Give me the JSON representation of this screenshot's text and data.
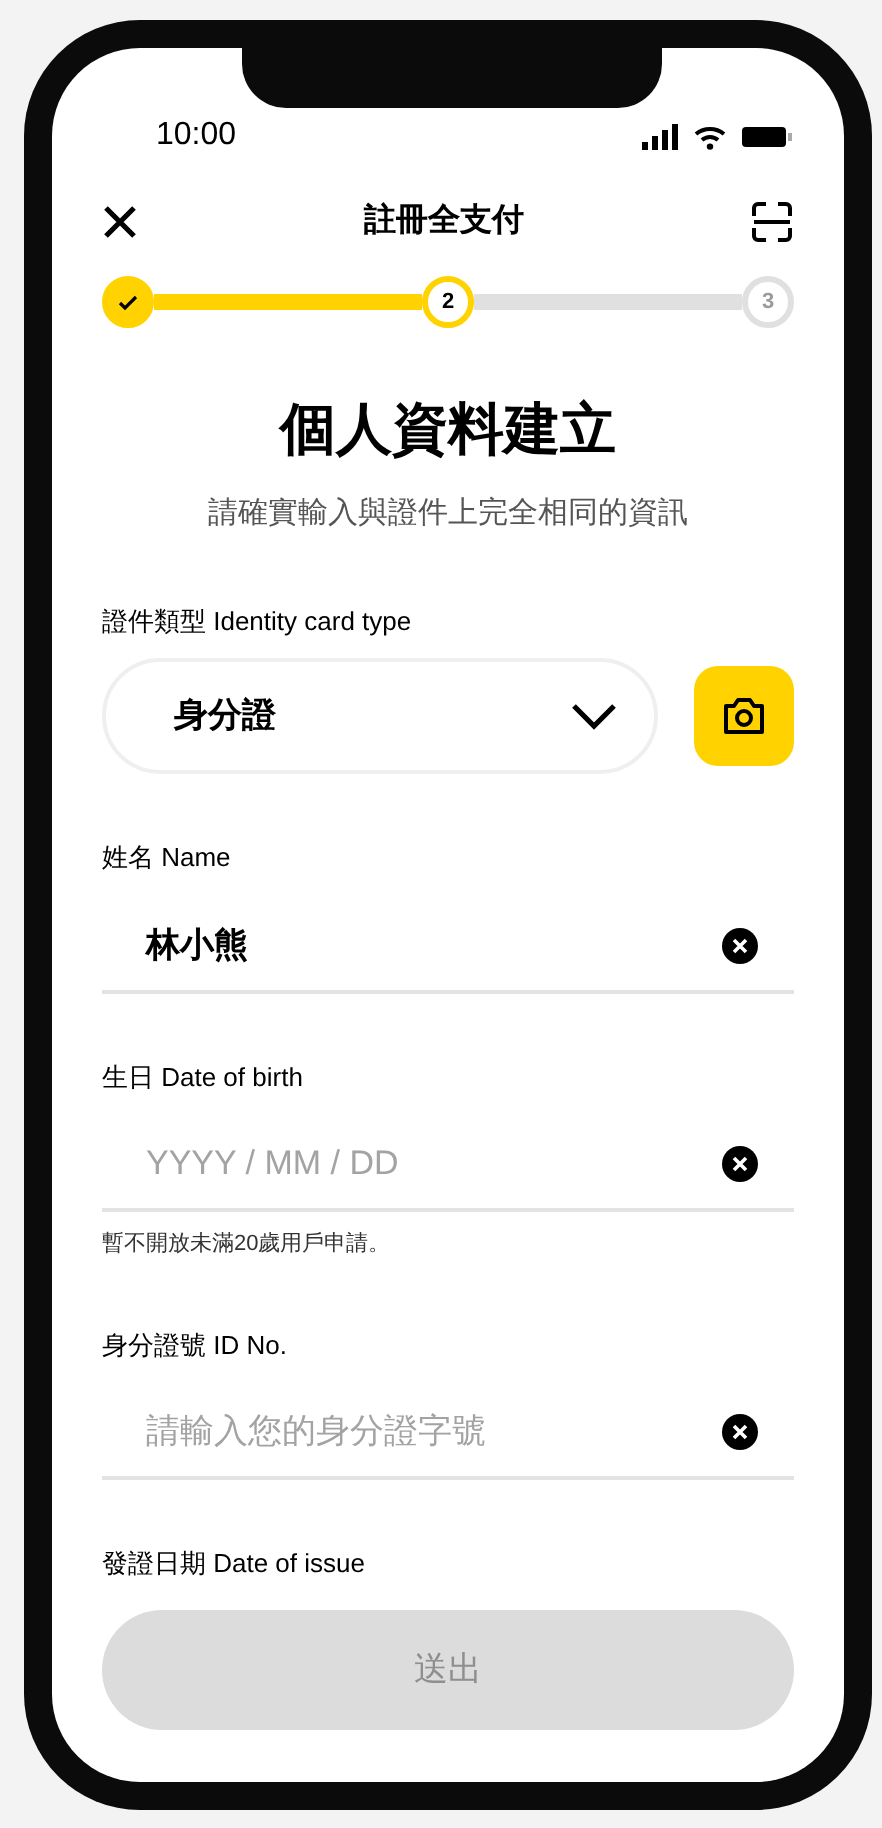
{
  "status_bar": {
    "time": "10:00"
  },
  "nav": {
    "title": "註冊全支付"
  },
  "stepper": [
    {
      "done": true,
      "selected": false
    },
    {
      "label": "2",
      "done": false,
      "selected": true
    },
    {
      "label": "3",
      "done": false,
      "selected": false
    }
  ],
  "heading": "個人資料建立",
  "subheading": "請確實輸入與證件上完全相同的資訊",
  "fields": [
    {
      "kind": "select",
      "label": "證件類型 Identity card type",
      "value": "身分證"
    },
    {
      "kind": "text",
      "label": "姓名 Name",
      "value": "林小熊"
    },
    {
      "kind": "text",
      "label": "生日 Date of birth",
      "placeholder": "YYYY / MM / DD",
      "hint": "暫不開放未滿20歲用戶申請。"
    },
    {
      "kind": "text",
      "label": "身分證號 ID No.",
      "placeholder": "請輸入您的身分證字號"
    },
    {
      "kind": "label",
      "label": "發證日期 Date of issue"
    }
  ],
  "submit": {
    "label": "送出",
    "disabled": true
  }
}
